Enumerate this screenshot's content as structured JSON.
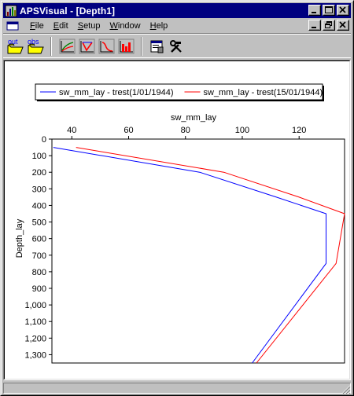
{
  "window": {
    "title": "APSVisual - [Depth1]",
    "title_bar_color": "#000080"
  },
  "menubar": {
    "items": [
      "File",
      "Edit",
      "Setup",
      "Window",
      "Help"
    ],
    "underline_letters": [
      "F",
      "E",
      "S",
      "W",
      "H"
    ]
  },
  "toolbar": {
    "buttons": [
      {
        "name": "open-output-button",
        "icon": "open-folder-out-icon",
        "label": "out"
      },
      {
        "name": "open-observed-button",
        "icon": "open-folder-obs-icon",
        "label": "obs"
      },
      {
        "name": "line-chart-button",
        "icon": "line-chart-icon"
      },
      {
        "name": "probability-chart-button",
        "icon": "probability-chart-icon"
      },
      {
        "name": "distribution-chart-button",
        "icon": "distribution-chart-icon"
      },
      {
        "name": "bar-chart-button",
        "icon": "bar-chart-icon"
      },
      {
        "name": "properties-button",
        "icon": "properties-icon"
      },
      {
        "name": "tools-button",
        "icon": "hammer-wrench-icon"
      }
    ]
  },
  "chart_data": {
    "type": "line",
    "title": "",
    "xlabel": "sw_mm_lay",
    "ylabel": "Depth_lay",
    "x_axis_position": "top",
    "y_axis_reversed": true,
    "xlim": [
      33,
      136
    ],
    "ylim": [
      0,
      1350
    ],
    "xticks": [
      40,
      60,
      80,
      100,
      120
    ],
    "yticks": [
      0,
      100,
      200,
      300,
      400,
      500,
      600,
      700,
      800,
      900,
      1000,
      1100,
      1200,
      1300
    ],
    "ytick_labels": [
      "0",
      "100",
      "200",
      "300",
      "400",
      "500",
      "600",
      "700",
      "800",
      "900",
      "1,000",
      "1,100",
      "1,200",
      "1,300"
    ],
    "grid": false,
    "legend_placement": "top",
    "series": [
      {
        "name": "sw_mm_lay - trest(1/01/1944)",
        "color": "#0000ff",
        "points": [
          [
            33.5,
            50
          ],
          [
            85,
            200
          ],
          [
            112,
            350
          ],
          [
            129.5,
            450
          ],
          [
            129.5,
            750
          ],
          [
            103.5,
            1350
          ]
        ]
      },
      {
        "name": "sw_mm_lay - trest(15/01/1944)",
        "color": "#ff0000",
        "points": [
          [
            41.5,
            50
          ],
          [
            93.5,
            200
          ],
          [
            120,
            350
          ],
          [
            136,
            450
          ],
          [
            133,
            750
          ],
          [
            105,
            1350
          ]
        ]
      }
    ]
  }
}
